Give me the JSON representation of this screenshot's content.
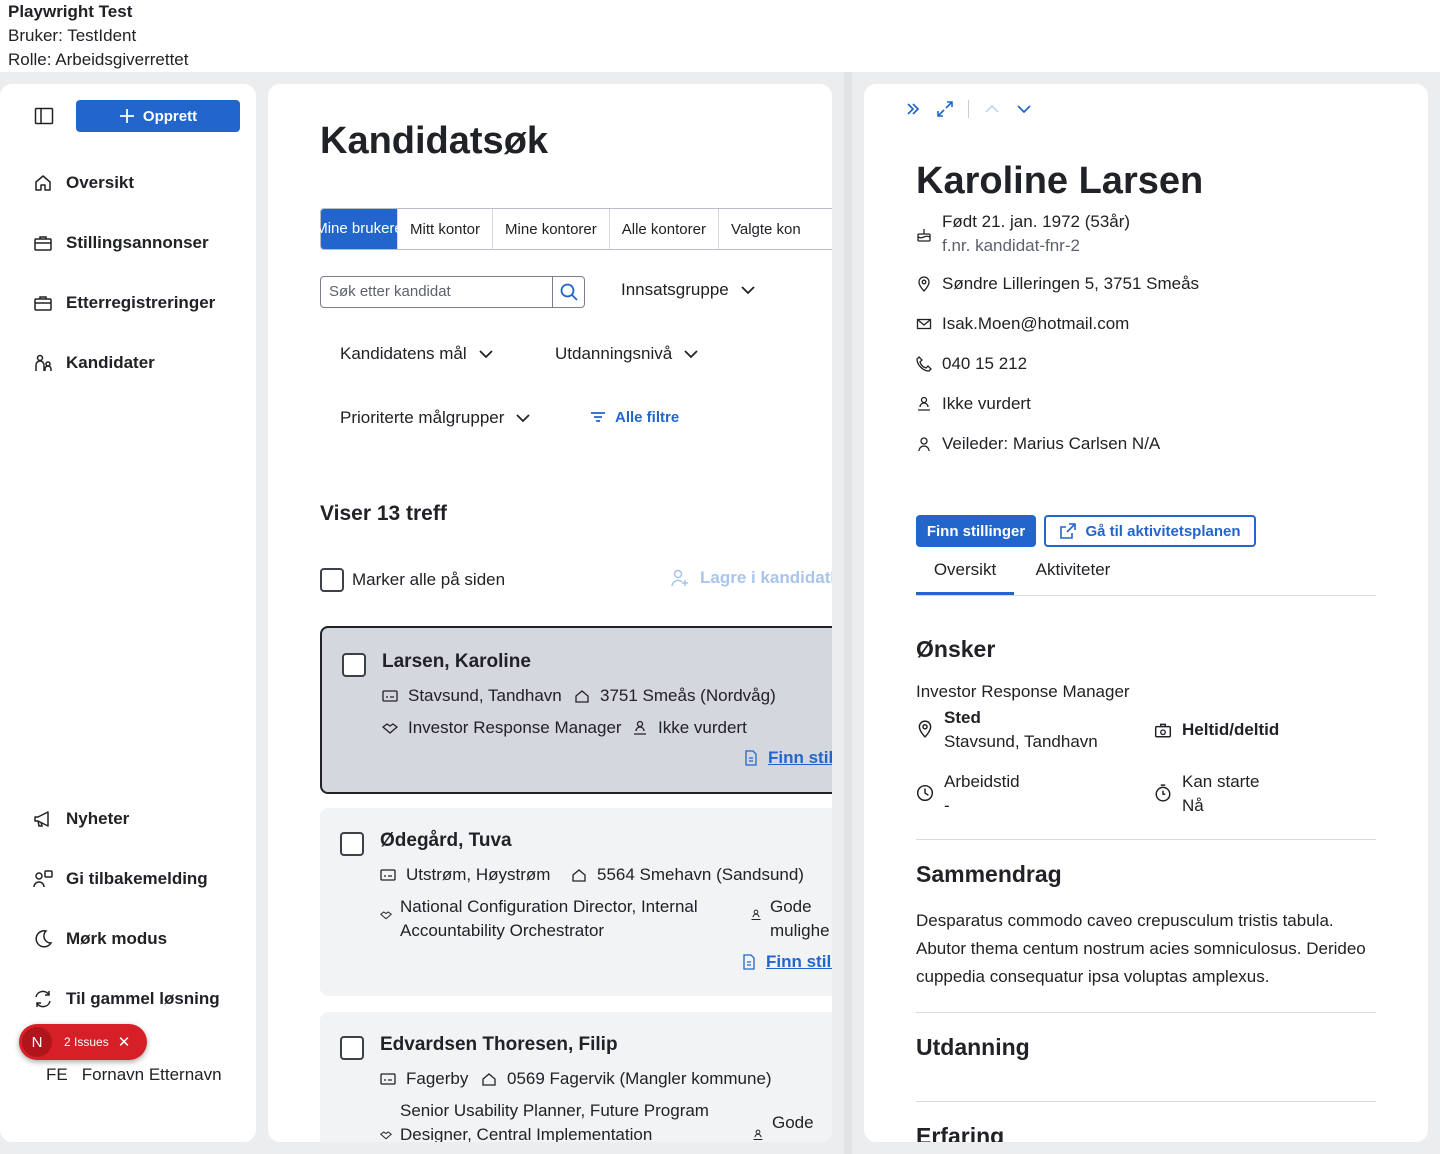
{
  "topbar": {
    "title": "Playwright Test",
    "user": "Bruker: TestIdent",
    "role": "Rolle: Arbeidsgiverrettet"
  },
  "sidebar": {
    "create_label": "Opprett",
    "items": [
      {
        "label": "Oversikt",
        "icon": "house-icon"
      },
      {
        "label": "Stillingsannonser",
        "icon": "briefcase-icon"
      },
      {
        "label": "Etterregistreringer",
        "icon": "briefcase-icon"
      },
      {
        "label": "Kandidater",
        "icon": "persons-icon"
      }
    ],
    "bottom_items": [
      {
        "label": "Nyheter",
        "icon": "megaphone-icon"
      },
      {
        "label": "Gi tilbakemelding",
        "icon": "feedback-icon"
      },
      {
        "label": "Mørk modus",
        "icon": "moon-icon"
      },
      {
        "label": "Til gammel løsning",
        "icon": "arrows-circle-icon"
      }
    ],
    "user_initials": "FE",
    "user_name": "Fornavn Etternavn"
  },
  "issues": {
    "letter": "N",
    "label": "2 Issues"
  },
  "list": {
    "title": "Kandidatsøk",
    "tabs": [
      "Mine brukere",
      "Mitt kontor",
      "Mine kontorer",
      "Alle kontorer",
      "Valgte kon"
    ],
    "search_placeholder": "Søk etter kandidat",
    "filters": [
      "Innsatsgruppe",
      "Kandidatens mål",
      "Utdanningsnivå",
      "Prioriterte målgrupper"
    ],
    "all_filters": "Alle filtre",
    "hits": "Viser 13 treff",
    "mark_all": "Marker alle på siden",
    "save_list": "Lagre i kandidatli",
    "find_label": "Finn still",
    "candidates": [
      {
        "name": "Larsen, Karoline",
        "area": "Stavsund, Tandhavn",
        "address": "3751 Smeås (Nordvåg)",
        "goal1": "Investor Response Manager",
        "goal2": "",
        "status": "Ikke vurdert"
      },
      {
        "name": "Ødegård, Tuva",
        "area": "Utstrøm, Høystrøm",
        "address": "5564 Smehavn (Sandsund)",
        "goal1": "National Configuration Director, Internal",
        "goal2": "Accountability Orchestrator",
        "status": "Gode",
        "status2": "mulighe"
      },
      {
        "name": "Edvardsen Thoresen, Filip",
        "area": "Fagerby",
        "address": "0569 Fagervik (Mangler kommune)",
        "goal1": "Senior Usability Planner, Future Program",
        "goal2": "Designer, Central Implementation",
        "status": "Gode"
      }
    ]
  },
  "detail": {
    "name": "Karoline Larsen",
    "born": "Født 21. jan. 1972 (53år)",
    "fnr": "f.nr. kandidat-fnr-2",
    "address": "Søndre Lilleringen 5, 3751 Smeås",
    "email": "Isak.Moen@hotmail.com",
    "phone": "040 15 212",
    "status": "Ikke vurdert",
    "veileder": "Veileder: Marius Carlsen N/A",
    "btn_find": "Finn stillinger",
    "btn_plan": "Gå til aktivitetsplanen",
    "tabs": [
      "Oversikt",
      "Aktiviteter"
    ],
    "wishes_title": "Ønsker",
    "wish_job": "Investor Response Manager",
    "place_label": "Sted",
    "place_value": "Stavsund, Tandhavn",
    "worktype": "Heltid/deltid",
    "worktime_label": "Arbeidstid",
    "worktime_value": "-",
    "start_label": "Kan starte",
    "start_value": "Nå",
    "summary_title": "Sammendrag",
    "summary_l1": "Desparatus commodo caveo crepusculum tristis tabula.",
    "summary_l2": "Abutor thema centum nostrum acies somniculosus. Derideo",
    "summary_l3": "cuppedia consequatur ipsa voluptas amplexus.",
    "education_title": "Utdanning",
    "experience_title": "Erfaring"
  },
  "colors": {
    "accent": "#2266cc",
    "danger": "#d61f26",
    "selected_card": "#d4d7dd"
  }
}
